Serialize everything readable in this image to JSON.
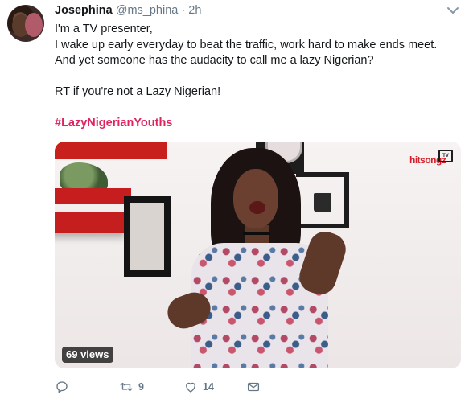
{
  "tweet": {
    "author": {
      "name": "Josephina",
      "handle": "@ms_phina",
      "separator": "·",
      "time": "2h"
    },
    "text_lines": [
      "I'm a TV presenter,",
      "I wake up early everyday to beat the traffic, work hard to make ends meet.",
      "And yet someone has the audacity to call me a lazy Nigerian?",
      "",
      "RT if you're not a Lazy Nigerian!",
      ""
    ],
    "hashtag": "#LazyNigerianYouths",
    "media": {
      "views_label": "69 views",
      "watermark": "hitsongz",
      "watermark_tv": "TV"
    },
    "actions": {
      "reply": {
        "icon": "reply-icon",
        "count": ""
      },
      "retweet": {
        "icon": "retweet-icon",
        "count": "9"
      },
      "like": {
        "icon": "heart-icon",
        "count": "14"
      },
      "dm": {
        "icon": "envelope-icon",
        "count": ""
      }
    },
    "colors": {
      "hashtag": "#e0245e",
      "secondary_text": "#657786"
    }
  }
}
